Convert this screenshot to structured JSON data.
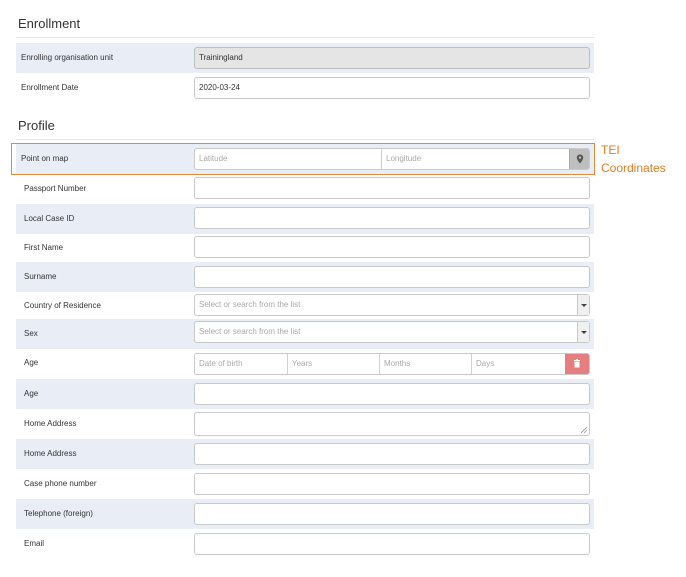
{
  "enrollment": {
    "title": "Enrollment",
    "org_unit_label": "Enrolling organisation unit",
    "org_unit_value": "Trainingland",
    "date_label": "Enrollment Date",
    "date_value": "2020-03-24"
  },
  "profile": {
    "title": "Profile",
    "point_label": "Point on map",
    "latitude_placeholder": "Latitude",
    "longitude_placeholder": "Longitude",
    "fields": [
      {
        "label": "Passport Number"
      },
      {
        "label": "Local Case ID"
      },
      {
        "label": "First Name"
      },
      {
        "label": "Surname"
      }
    ],
    "country_label": "Country of Residence",
    "country_placeholder": "Select or search from the list",
    "sex_label": "Sex",
    "sex_placeholder": "Select or search from the list",
    "age_label": "Age",
    "dob_placeholder": "Date of birth",
    "years_placeholder": "Years",
    "months_placeholder": "Months",
    "days_placeholder": "Days",
    "age2_label": "Age",
    "home_address_label": "Home Address",
    "home_address2_label": "Home Address",
    "case_phone_label": "Case phone number",
    "tel_foreign_label": "Telephone (foreign)",
    "email_label": "Email"
  },
  "annotation": {
    "text_line1": "TEI",
    "text_line2": "Coordinates",
    "color": "#e07b1f"
  },
  "colors": {
    "row_shade": "#e9eef6",
    "delete_button": "#e57f7f",
    "map_button": "#bfbfbf"
  },
  "icons": {
    "map": "map-marker-icon",
    "delete": "trash-icon",
    "dropdown": "caret-down-icon"
  }
}
